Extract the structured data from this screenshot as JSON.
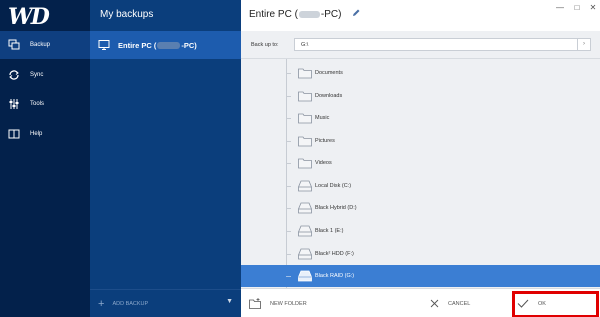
{
  "nav": {
    "logo": "WD",
    "items": [
      {
        "label": "Backup",
        "icon": "backup-icon"
      },
      {
        "label": "Sync",
        "icon": "sync-icon"
      },
      {
        "label": "Tools",
        "icon": "tools-icon"
      },
      {
        "label": "Help",
        "icon": "help-book-icon"
      }
    ]
  },
  "backups": {
    "title": "My backups",
    "selected_item": {
      "label_prefix": "Entire PC (",
      "label_suffix": "-PC)",
      "icon": "monitor-icon"
    },
    "add_label": "ADD BACKUP"
  },
  "main": {
    "title_prefix": "Entire PC (",
    "title_suffix": "-PC)",
    "backup_to_label": "Back up to:",
    "backup_to_value": "G:\\",
    "tree": [
      {
        "label": "Documents",
        "type": "folder"
      },
      {
        "label": "Downloads",
        "type": "folder"
      },
      {
        "label": "Music",
        "type": "folder"
      },
      {
        "label": "Pictures",
        "type": "folder"
      },
      {
        "label": "Videos",
        "type": "folder"
      },
      {
        "label": "Local Disk (C:)",
        "type": "drive"
      },
      {
        "label": "Black Hybrid (D:)",
        "type": "drive"
      },
      {
        "label": "Black 1 (E:)",
        "type": "drive"
      },
      {
        "label": "Black² HDD (F:)",
        "type": "drive"
      },
      {
        "label": "Black RAID (G:)",
        "type": "drive",
        "selected": true
      }
    ],
    "footer": {
      "new_folder": "NEW FOLDER",
      "cancel": "CANCEL",
      "ok": "OK"
    }
  },
  "colors": {
    "nav_bg": "#03214b",
    "backups_bg": "#0b3e7c",
    "selected_blue": "#3b7ed3",
    "highlight_red": "#e00000"
  }
}
